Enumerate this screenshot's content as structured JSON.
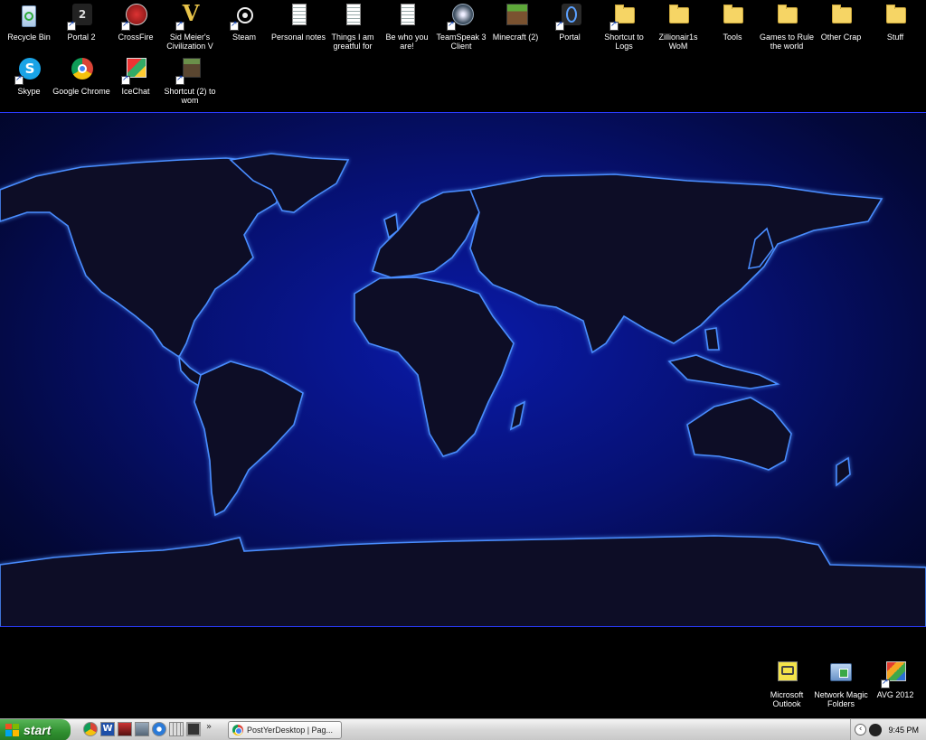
{
  "desktop": {
    "icons_top_row": [
      {
        "id": "recycle-bin",
        "label": "Recycle Bin",
        "icon": "recycle-bin-icon"
      },
      {
        "id": "portal-2",
        "label": "Portal 2",
        "icon": "portal2-icon"
      },
      {
        "id": "crossfire",
        "label": "CrossFire",
        "icon": "crossfire-icon"
      },
      {
        "id": "civilization-v",
        "label": "Sid Meier's Civilization V",
        "icon": "civilization-icon"
      },
      {
        "id": "steam",
        "label": "Steam",
        "icon": "steam-icon"
      },
      {
        "id": "personal-notes",
        "label": "Personal notes",
        "icon": "text-document-icon"
      },
      {
        "id": "things-grateful",
        "label": "Things I am greatful for",
        "icon": "text-document-icon"
      },
      {
        "id": "be-who-you-are",
        "label": "Be who you are!",
        "icon": "text-document-icon"
      },
      {
        "id": "teamspeak",
        "label": "TeamSpeak 3 Client",
        "icon": "teamspeak-icon"
      },
      {
        "id": "minecraft-2",
        "label": "Minecraft (2)",
        "icon": "minecraft-icon"
      },
      {
        "id": "portal",
        "label": "Portal",
        "icon": "portal-icon"
      },
      {
        "id": "shortcut-logs",
        "label": "Shortcut to Logs",
        "icon": "folder-shortcut-icon"
      },
      {
        "id": "zillionair",
        "label": "Zillionair1s WoM",
        "icon": "folder-icon"
      },
      {
        "id": "tools",
        "label": "Tools",
        "icon": "folder-icon"
      },
      {
        "id": "games-rule",
        "label": "Games to Rule the world",
        "icon": "folder-icon"
      },
      {
        "id": "other-crap",
        "label": "Other Crap",
        "icon": "folder-icon"
      },
      {
        "id": "stuff",
        "label": "Stuff",
        "icon": "folder-icon"
      }
    ],
    "icons_second_row": [
      {
        "id": "skype",
        "label": "Skype",
        "icon": "skype-icon"
      },
      {
        "id": "google-chrome",
        "label": "Google Chrome",
        "icon": "chrome-icon"
      },
      {
        "id": "icechat",
        "label": "IceChat",
        "icon": "icechat-icon"
      },
      {
        "id": "shortcut-wom",
        "label": "Shortcut (2) to wom",
        "icon": "minecraft-block-icon"
      }
    ],
    "icons_bottom_right": [
      {
        "id": "ms-outlook",
        "label": "Microsoft Outlook",
        "icon": "outlook-icon"
      },
      {
        "id": "network-magic",
        "label": "Network Magic Folders",
        "icon": "network-folder-icon"
      },
      {
        "id": "avg-2012",
        "label": "AVG 2012",
        "icon": "avg-icon"
      }
    ],
    "wallpaper": "glowing-world-map"
  },
  "taskbar": {
    "start_label": "start",
    "quick_launch": [
      "chrome-icon",
      "word-icon",
      "media-icon",
      "network-icon",
      "ie-icon",
      "calculator-icon",
      "monitor-icon"
    ],
    "quick_launch_more": "»",
    "task_button_label": "PostYerDesktop | Pag...",
    "tray_expand": "‹",
    "clock": "9:45 PM"
  },
  "colors": {
    "map_glow": "#3a7bff",
    "map_fill": "#0b0f2a",
    "ocean": "#061070",
    "start_green": "#2f8f2f",
    "folder_yellow": "#f6d565"
  }
}
